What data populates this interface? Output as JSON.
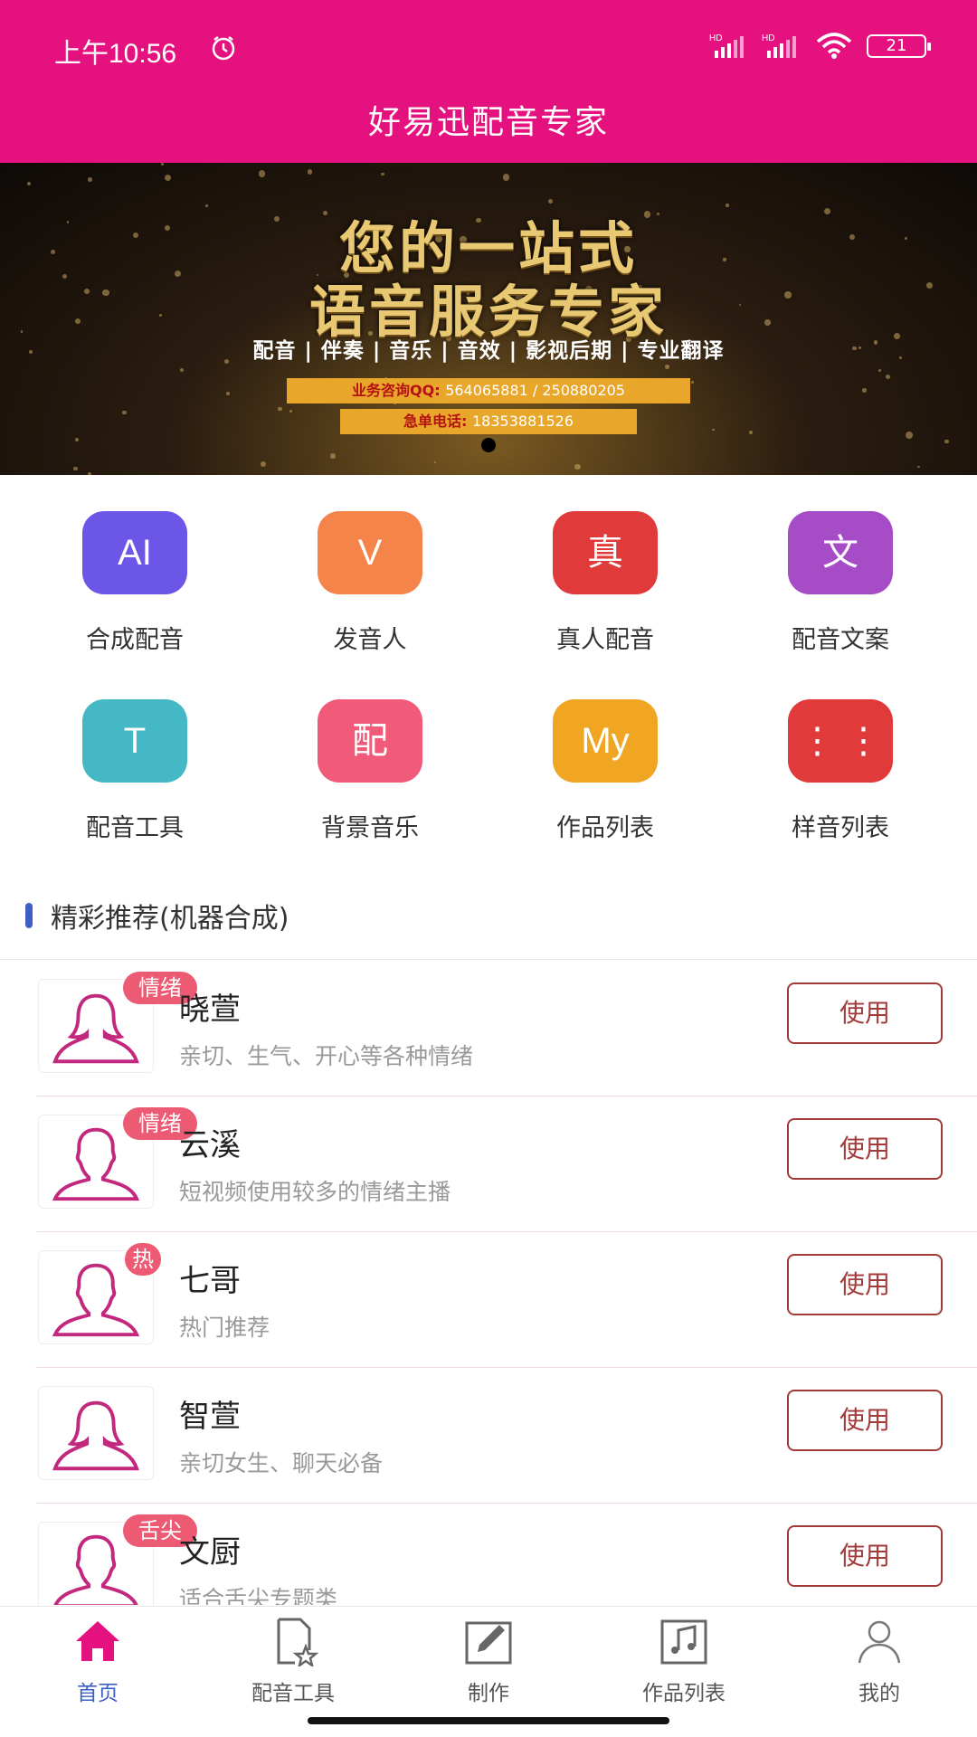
{
  "status": {
    "time": "上午10:56",
    "battery": "21",
    "hd1": "HD",
    "hd2": "HD"
  },
  "header": {
    "title": "好易迅配音专家"
  },
  "banner": {
    "line1": "您的一站式",
    "line2": "语音服务专家",
    "services": "配音 | 伴奏 | 音乐 | 音效 | 影视后期 | 专业翻译",
    "qq_label": "业务咨询QQ:",
    "qq_value": "564065881 / 250880205",
    "phone_label": "急单电话:",
    "phone_value": "18353881526"
  },
  "grid": [
    {
      "icon_text": "AI",
      "label": "合成配音",
      "color": "#6c56e8",
      "icon": "ai-icon"
    },
    {
      "icon_text": "V",
      "label": "发音人",
      "color": "#f4844a",
      "icon": "voice-icon"
    },
    {
      "icon_text": "真",
      "label": "真人配音",
      "color": "#e03a3a",
      "icon": "real-icon"
    },
    {
      "icon_text": "文",
      "label": "配音文案",
      "color": "#a64cc6",
      "icon": "text-icon"
    },
    {
      "icon_text": "T",
      "label": "配音工具",
      "color": "#44b8c4",
      "icon": "tool-icon"
    },
    {
      "icon_text": "配",
      "label": "背景音乐",
      "color": "#f25a7a",
      "icon": "music-icon"
    },
    {
      "icon_text": "My",
      "label": "作品列表",
      "color": "#f0a623",
      "icon": "works-icon"
    },
    {
      "icon_text": "⋮ ⋮",
      "label": "样音列表",
      "color": "#e03a3a",
      "icon": "sample-icon"
    }
  ],
  "section": {
    "title": "精彩推荐(机器合成)"
  },
  "list": [
    {
      "name": "晓萱",
      "desc": "亲切、生气、开心等各种情绪",
      "badge": "情绪",
      "gender": "female",
      "button": "使用"
    },
    {
      "name": "云溪",
      "desc": "短视频使用较多的情绪主播",
      "badge": "情绪",
      "gender": "male",
      "button": "使用"
    },
    {
      "name": "七哥",
      "desc": "热门推荐",
      "badge": "热",
      "gender": "male",
      "button": "使用"
    },
    {
      "name": "智萱",
      "desc": "亲切女生、聊天必备",
      "badge": "",
      "gender": "female",
      "button": "使用"
    },
    {
      "name": "文厨",
      "desc": "适合舌尖专题类",
      "badge": "舌尖",
      "gender": "male",
      "button": "使用"
    }
  ],
  "nav": [
    {
      "label": "首页",
      "icon": "home-icon",
      "active": true
    },
    {
      "label": "配音工具",
      "icon": "document-star-icon",
      "active": false
    },
    {
      "label": "制作",
      "icon": "edit-icon",
      "active": false
    },
    {
      "label": "作品列表",
      "icon": "music-note-icon",
      "active": false
    },
    {
      "label": "我的",
      "icon": "user-icon",
      "active": false
    }
  ],
  "colors": {
    "brand": "#e5117f",
    "accent": "#3b5fc4",
    "button_border": "#a33a3a",
    "badge": "#ec5b73"
  }
}
